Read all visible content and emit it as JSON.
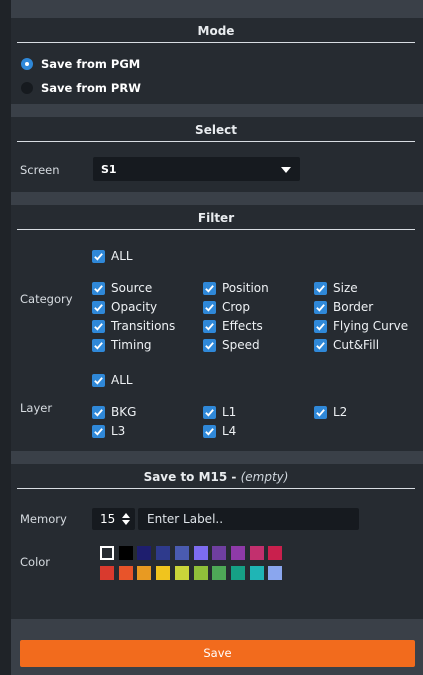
{
  "mode": {
    "title": "Mode",
    "options": [
      {
        "label": "Save from PGM",
        "selected": true
      },
      {
        "label": "Save from PRW",
        "selected": false
      }
    ]
  },
  "select": {
    "title": "Select",
    "screen_label": "Screen",
    "screen_value": "S1"
  },
  "filter": {
    "title": "Filter",
    "category_label": "Category",
    "category_all": "ALL",
    "categories": [
      {
        "label": "Source",
        "checked": true
      },
      {
        "label": "Position",
        "checked": true
      },
      {
        "label": "Size",
        "checked": true
      },
      {
        "label": "Opacity",
        "checked": true
      },
      {
        "label": "Crop",
        "checked": true
      },
      {
        "label": "Border",
        "checked": true
      },
      {
        "label": "Transitions",
        "checked": true
      },
      {
        "label": "Effects",
        "checked": true
      },
      {
        "label": "Flying Curve",
        "checked": true
      },
      {
        "label": "Timing",
        "checked": true
      },
      {
        "label": "Speed",
        "checked": true
      },
      {
        "label": "Cut&Fill",
        "checked": true
      }
    ],
    "layer_label": "Layer",
    "layer_all": "ALL",
    "layers": [
      {
        "label": "BKG",
        "checked": true
      },
      {
        "label": "L1",
        "checked": true
      },
      {
        "label": "L2",
        "checked": true
      },
      {
        "label": "L3",
        "checked": true
      },
      {
        "label": "L4",
        "checked": true
      }
    ]
  },
  "save_to": {
    "title": "Save to M15 - ",
    "title_status": "(empty)",
    "memory_label": "Memory",
    "memory_value": "15",
    "label_placeholder": "Enter Label..",
    "color_label": "Color",
    "colors": [
      "#ffffff",
      "#000000",
      "#1e1e6e",
      "#2e3a8c",
      "#4a5bb0",
      "#7d6cf0",
      "#6f3fa0",
      "#8e3aa8",
      "#c2306e",
      "#c9204d",
      "#d93a2e",
      "#e8542a",
      "#e89a22",
      "#f0c41e",
      "#c9d43a",
      "#8fbf3a",
      "#4ea857",
      "#16a085",
      "#1fb5b5",
      "#8aa6ee"
    ]
  },
  "save_button": "Save"
}
